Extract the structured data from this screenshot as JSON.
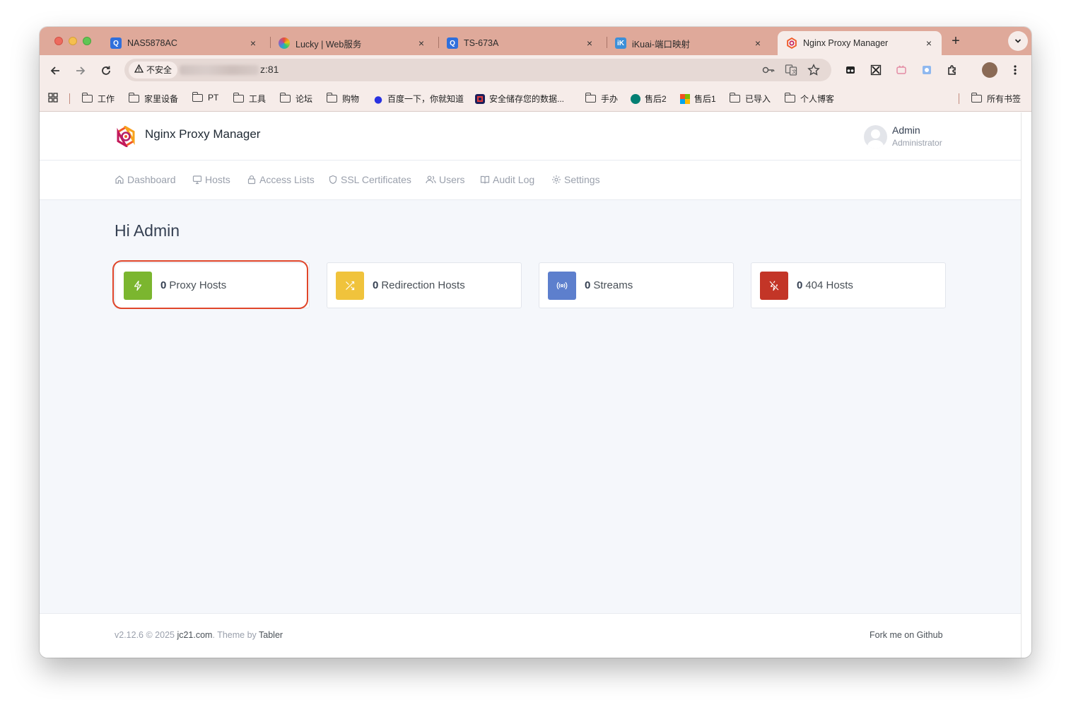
{
  "browser": {
    "tabs": [
      {
        "title": "NAS5878AC",
        "favicon": "qnap-icon",
        "active": false
      },
      {
        "title": "Lucky | Web服务",
        "favicon": "lucky-icon",
        "active": false
      },
      {
        "title": "TS-673A",
        "favicon": "qnap-icon",
        "active": false
      },
      {
        "title": "iKuai-端口映射",
        "favicon": "ikuai-icon",
        "active": false
      },
      {
        "title": "Nginx Proxy Manager",
        "favicon": "npm-icon",
        "active": true
      }
    ],
    "close_glyph": "×",
    "new_tab_glyph": "+",
    "security_label": "不安全",
    "url_visible": "z:81",
    "bookmarks": [
      {
        "label": "工作",
        "icon": "folder-icon"
      },
      {
        "label": "家里设备",
        "icon": "folder-icon"
      },
      {
        "label": "PT",
        "icon": "folder-icon"
      },
      {
        "label": "工具",
        "icon": "folder-icon"
      },
      {
        "label": "论坛",
        "icon": "folder-icon"
      },
      {
        "label": "购物",
        "icon": "folder-icon"
      },
      {
        "label": "百度一下，你就知道",
        "icon": "baidu-icon"
      },
      {
        "label": "安全储存您的数据...",
        "icon": "storage-icon"
      },
      {
        "label": "手办",
        "icon": "folder-icon"
      },
      {
        "label": "售后2",
        "icon": "sharepoint-icon"
      },
      {
        "label": "售后1",
        "icon": "microsoft-icon"
      },
      {
        "label": "已导入",
        "icon": "folder-icon"
      },
      {
        "label": "个人博客",
        "icon": "folder-icon"
      }
    ],
    "all_bookmarks_label": "所有书签"
  },
  "app": {
    "brand": "Nginx Proxy Manager",
    "user": {
      "name": "Admin",
      "role": "Administrator"
    },
    "nav": [
      {
        "label": "Dashboard",
        "icon": "home-icon"
      },
      {
        "label": "Hosts",
        "icon": "monitor-icon"
      },
      {
        "label": "Access Lists",
        "icon": "lock-icon"
      },
      {
        "label": "SSL Certificates",
        "icon": "shield-icon"
      },
      {
        "label": "Users",
        "icon": "users-icon"
      },
      {
        "label": "Audit Log",
        "icon": "book-icon"
      },
      {
        "label": "Settings",
        "icon": "gear-icon"
      }
    ],
    "greeting": "Hi Admin",
    "cards": [
      {
        "count": "0",
        "label": "Proxy Hosts",
        "icon": "zap-icon",
        "color": "#7bb62f"
      },
      {
        "count": "0",
        "label": "Redirection Hosts",
        "icon": "shuffle-icon",
        "color": "#f0c33c"
      },
      {
        "count": "0",
        "label": "Streams",
        "icon": "radio-icon",
        "color": "#5d7fcd"
      },
      {
        "count": "0",
        "label": "404 Hosts",
        "icon": "zap-off-icon",
        "color": "#c33527"
      }
    ],
    "footer": {
      "version": "v2.12.6 © 2025 ",
      "author_link": "jc21.com",
      "theme_text": ". Theme by ",
      "theme_link": "Tabler",
      "github_link": "Fork me on Github"
    }
  }
}
